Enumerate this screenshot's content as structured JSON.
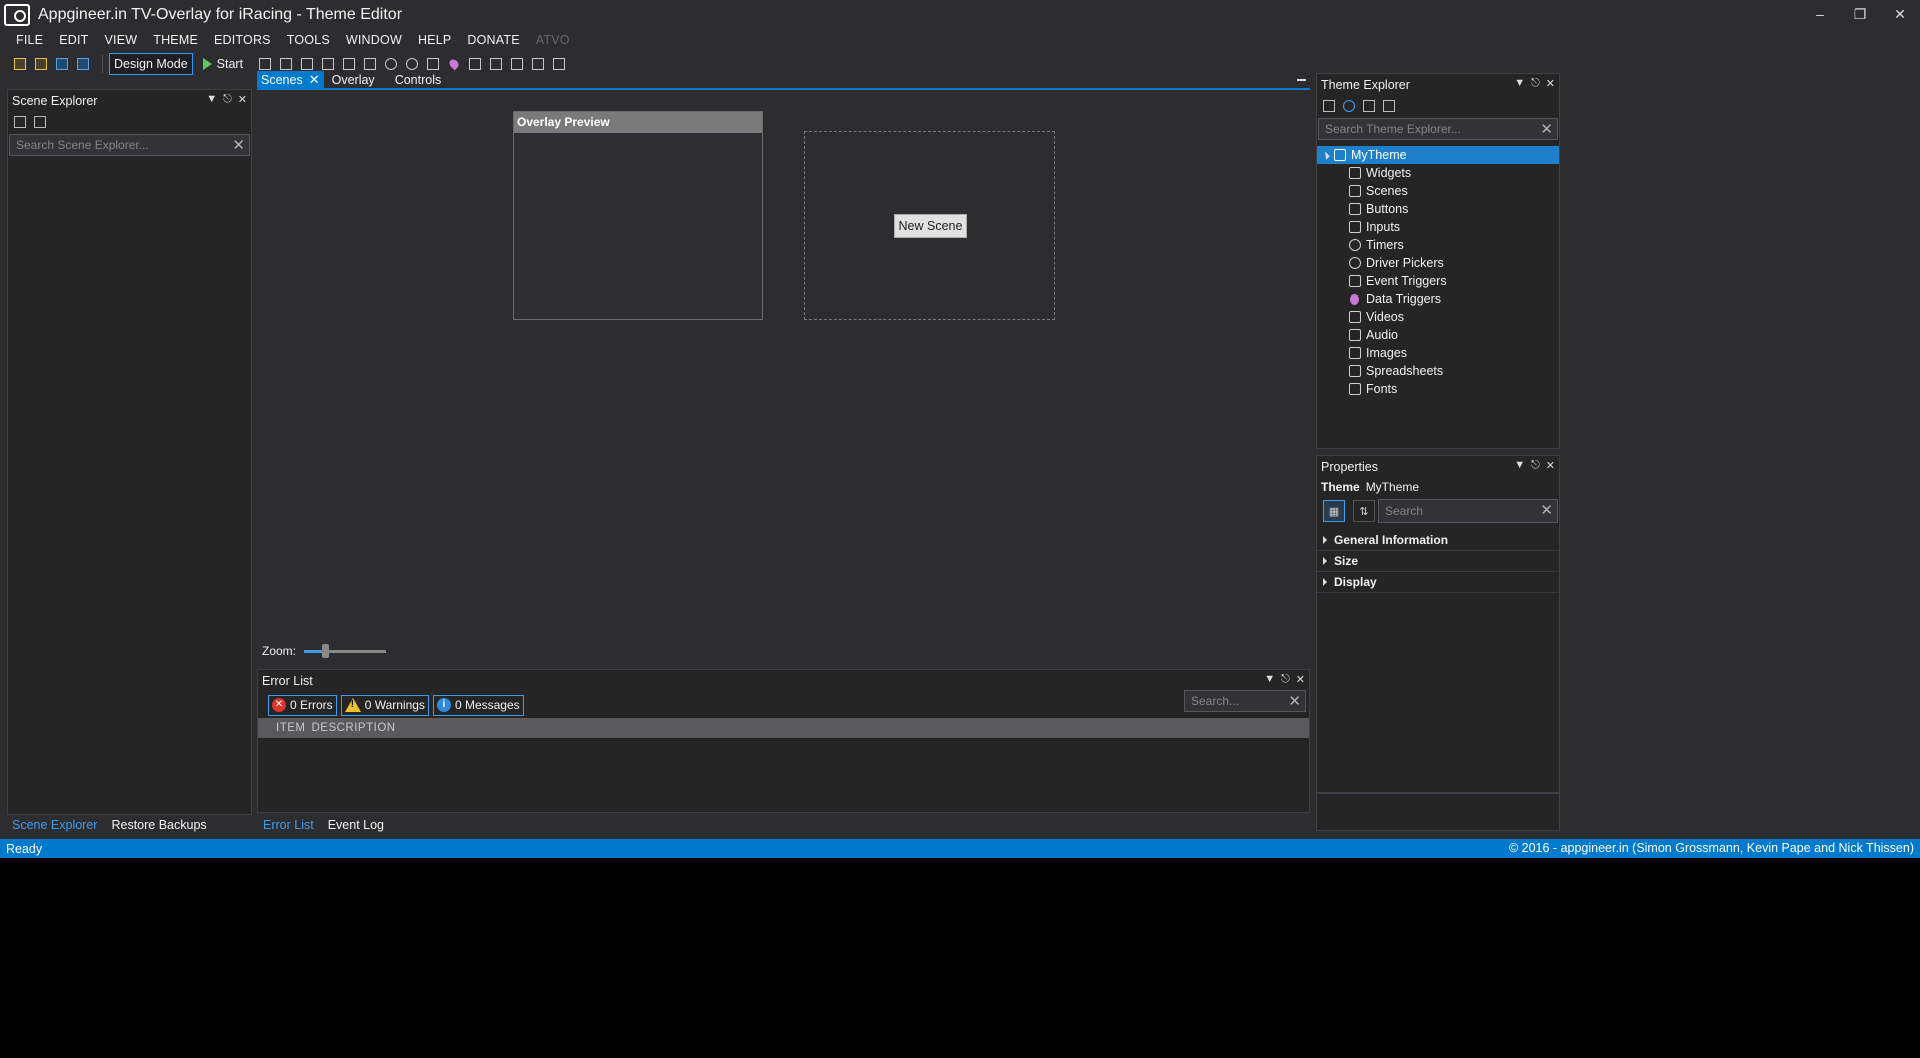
{
  "window": {
    "title": "Appgineer.in TV-Overlay for iRacing - Theme Editor"
  },
  "menu": [
    "FILE",
    "EDIT",
    "VIEW",
    "THEME",
    "EDITORS",
    "TOOLS",
    "WINDOW",
    "HELP",
    "DONATE",
    "ATVO"
  ],
  "toolbar": {
    "design_mode": "Design Mode",
    "start": "Start"
  },
  "scene_explorer": {
    "title": "Scene Explorer",
    "search_placeholder": "Search Scene Explorer...",
    "bottom_tabs": [
      "Scene Explorer",
      "Restore Backups"
    ]
  },
  "doc_tabs": [
    "Scenes",
    "Overlay",
    "Controls"
  ],
  "canvas": {
    "preview_title": "Overlay Preview",
    "new_scene": "New Scene",
    "zoom_label": "Zoom:",
    "zoom_value": 0.25
  },
  "error_list": {
    "title": "Error List",
    "errors": "0 Errors",
    "warnings": "0 Warnings",
    "messages": "0 Messages",
    "search_placeholder": "Search...",
    "columns": [
      "ITEM",
      "DESCRIPTION"
    ],
    "bottom_tabs": [
      "Error List",
      "Event Log"
    ]
  },
  "theme_explorer": {
    "title": "Theme Explorer",
    "search_placeholder": "Search Theme Explorer...",
    "root": "MyTheme",
    "items": [
      "Widgets",
      "Scenes",
      "Buttons",
      "Inputs",
      "Timers",
      "Driver Pickers",
      "Event Triggers",
      "Data Triggers",
      "Videos",
      "Audio",
      "Images",
      "Spreadsheets",
      "Fonts"
    ]
  },
  "properties": {
    "title": "Properties",
    "object_type": "Theme",
    "object_name": "MyTheme",
    "search_placeholder": "Search",
    "categories": [
      "General Information",
      "Size",
      "Display"
    ]
  },
  "status": {
    "left": "Ready",
    "right": "© 2016 - appgineer.in (Simon Grossmann, Kevin Pape and Nick Thissen)"
  },
  "colors": {
    "accent": "#007acc",
    "background": "#2d2d30",
    "panel": "#252526"
  }
}
